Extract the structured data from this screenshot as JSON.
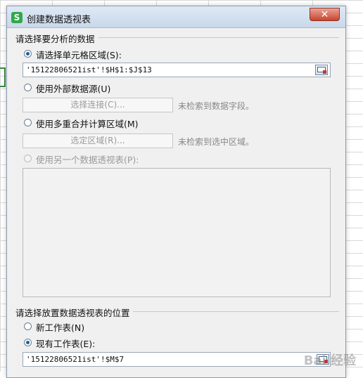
{
  "dialog": {
    "title": "创建数据透视表",
    "app_icon_letter": "S",
    "close_glyph": "✕"
  },
  "source_group": {
    "title": "请选择要分析的数据",
    "opt_range_label": "请选择单元格区域(S):",
    "range_value": "'15122806521ist'!$H$1:$J$13",
    "opt_external_label": "使用外部数据源(U)",
    "choose_connection_label": "选择连接(C)...",
    "connection_hint": "未检索到数据字段。",
    "opt_consolidate_label": "使用多重合并计算区域(M)",
    "select_range_label": "选定区域(R)...",
    "range_hint": "未检索到选中区域。",
    "opt_other_pivot_label": "使用另一个数据透视表(P):"
  },
  "dest_group": {
    "title": "请选择放置数据透视表的位置",
    "opt_new_sheet_label": "新工作表(N)",
    "opt_existing_sheet_label": "现有工作表(E):",
    "existing_value": "'15122806521ist'!$M$7"
  },
  "watermark": "Bai 经验"
}
